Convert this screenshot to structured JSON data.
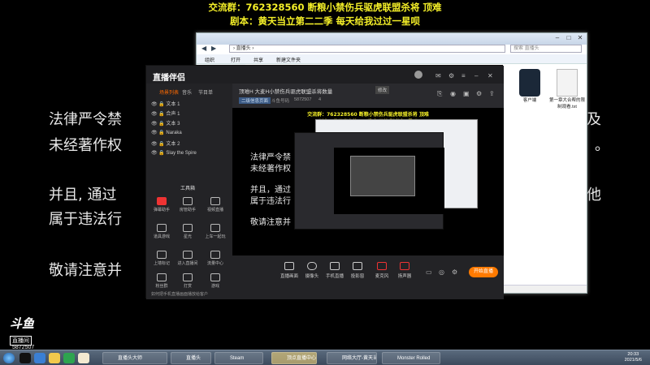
{
  "overlay": {
    "line1": "交流群：762328560 断粮小禁伤兵驱虎联盟杀将 顶难",
    "line2": "剧本：黄天当立第二二季 每天给我过过一星呗"
  },
  "background_text": {
    "l1": "法律严令禁",
    "l1r": "及",
    "l2": "未经著作权",
    "l2r": "。",
    "l3": "并且, 通过",
    "l3r": "他",
    "l4": "属于违法行",
    "l5": "敬请注意并"
  },
  "explorer": {
    "address": "› 直播头 ›",
    "search": "搜索 直播头",
    "menu": [
      "组织",
      "打开",
      "共享",
      "新建文件夹"
    ],
    "files": [
      {
        "name": "客户端"
      },
      {
        "name": "第一章大合帮的限制观看.txt"
      }
    ]
  },
  "app": {
    "logo": "直播伴侣",
    "left_tabs": [
      "场景列表",
      "音乐",
      "节目单"
    ],
    "scenes": [
      "文本 1",
      "合声 1",
      "文本 3",
      "Naraka",
      "文本 2",
      "Slay the Spire"
    ],
    "tools_title": "工具箱",
    "tools": [
      "弹幕助手",
      "房管助手",
      "视频直播",
      "道具游戏",
      "星光",
      "上车一起玩",
      "上墙标记",
      "进入直播间",
      "流量中心",
      "粉丝群",
      "打赏",
      "游戏"
    ],
    "notice": "如何把手机直播画面播放给客户",
    "room_title": "顶难H 大麦H小禁伤兵驱虎联盟杀将数量",
    "tag": "修改",
    "mini_info": [
      "二级信息页面",
      "斗鱼号码",
      "5872507",
      "4"
    ],
    "bottom_buttons": [
      "直播画面",
      "摄像头",
      "手机直播",
      "投影窗",
      "麦克风",
      "扬声器"
    ],
    "live_button": "开始直播"
  },
  "preview": {
    "ov1": "交流群：762328560 断粮小禁伤兵驱虎联盟杀将 顶难",
    "ov2": "剧本：黄天当立第二二季 每天给我过过一星呗",
    "t1": "法律严令禁",
    "t2": "未经著作权",
    "t3": "并且，通过",
    "t4": "属于违法行",
    "t5": "敬请注意并"
  },
  "douyu": {
    "logo_top": "斗鱼",
    "logo_bottom": "直播间",
    "room_id": "5872507"
  },
  "taskbar": {
    "tasks": [
      "直播头大师",
      "直播头",
      "Steam",
      "顶点直播中心",
      "网络大厅-黄天当立",
      "Monster Rolled"
    ],
    "time": "20:33",
    "date": "2021/5/6"
  }
}
